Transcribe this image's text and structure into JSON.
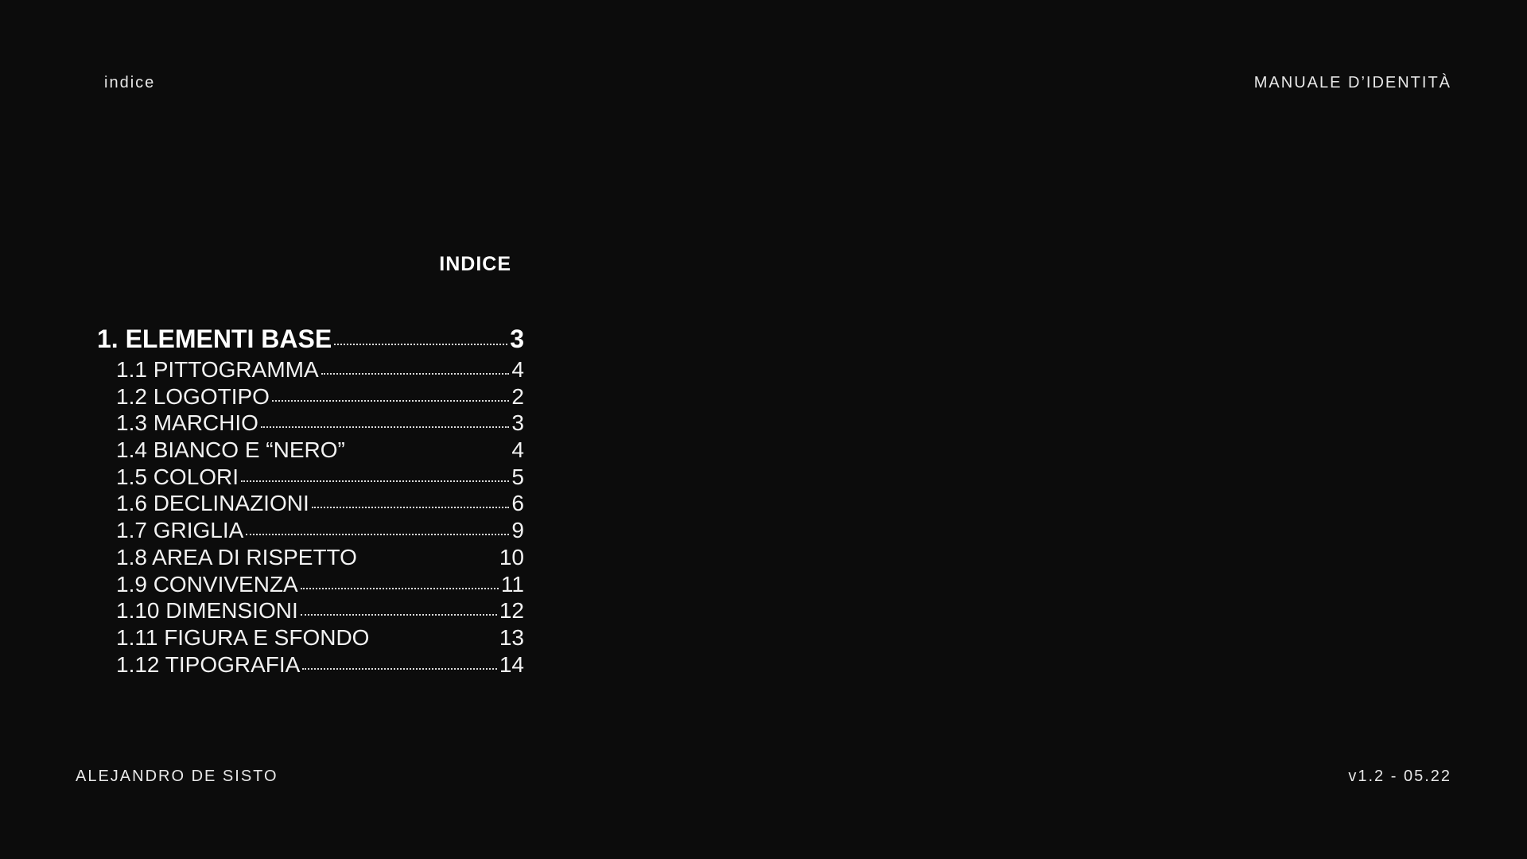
{
  "header": {
    "section_label": "indice",
    "document_title": "MANUALE D’IDENTITÀ"
  },
  "footer": {
    "author": "ALEJANDRO DE SISTO",
    "version": "v1.2 - 05.22"
  },
  "index": {
    "heading": "INDICE",
    "chapter": {
      "label": "1. ELEMENTI BASE",
      "page": "3"
    },
    "entries": [
      {
        "label": "1.1 PITTOGRAMMA",
        "page": "4"
      },
      {
        "label": "1.2 LOGOTIPO",
        "page": "2"
      },
      {
        "label": "1.3 MARCHIO",
        "page": "3"
      },
      {
        "label": "1.4 BIANCO E “NERO”",
        "page": "4"
      },
      {
        "label": "1.5 COLORI",
        "page": "5"
      },
      {
        "label": "1.6 DECLINAZIONI",
        "page": "6"
      },
      {
        "label": "1.7 GRIGLIA",
        "page": "9"
      },
      {
        "label": "1.8 AREA DI RISPETTO",
        "page": "10"
      },
      {
        "label": "1.9 CONVIVENZA",
        "page": "11"
      },
      {
        "label": "1.10 DIMENSIONI",
        "page": "12"
      },
      {
        "label": "1.11 FIGURA E SFONDO",
        "page": "13"
      },
      {
        "label": "1.12 TIPOGRAFIA",
        "page": "14"
      }
    ]
  }
}
